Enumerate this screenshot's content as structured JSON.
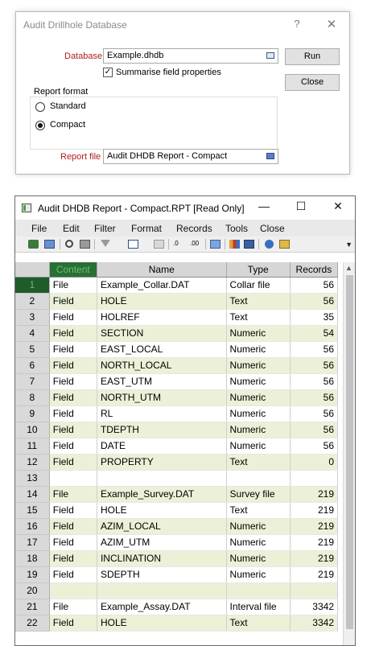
{
  "dialog": {
    "title": "Audit Drillhole Database",
    "help_icon": "?",
    "close_icon": "✕",
    "database_label": "Database",
    "database_value": "Example.dhdb",
    "summarise_checked": true,
    "summarise_label": "Summarise field properties",
    "report_format_label": "Report format",
    "radio_standard": "Standard",
    "radio_compact": "Compact",
    "selected_format": "Compact",
    "report_file_label": "Report file",
    "report_file_value": "Audit DHDB Report - Compact",
    "run_button": "Run",
    "close_button": "Close"
  },
  "report": {
    "title": "Audit DHDB Report - Compact.RPT [Read Only]",
    "minimize": "—",
    "maximize": "☐",
    "close": "✕",
    "menu": [
      "File",
      "Edit",
      "Filter",
      "Format",
      "Records",
      "Tools",
      "Close"
    ],
    "toolbar_icons": [
      "refresh-icon",
      "copy-icon",
      "find-icon",
      "print-icon",
      "filter-icon",
      "columns-icon",
      "grid-icon",
      "decrease-decimals-icon",
      "increase-decimals-icon",
      "export-icon",
      "chart-icon",
      "table-icon",
      "help-icon",
      "settings-icon"
    ],
    "columns": [
      "Content",
      "Name",
      "Type",
      "Records"
    ],
    "active_row": 1,
    "rows": [
      {
        "n": "1",
        "content": "File",
        "name": "Example_Collar.DAT",
        "type": "Collar file",
        "records": "56"
      },
      {
        "n": "2",
        "content": "Field",
        "name": "HOLE",
        "type": "Text",
        "records": "56"
      },
      {
        "n": "3",
        "content": "Field",
        "name": "HOLREF",
        "type": "Text",
        "records": "35"
      },
      {
        "n": "4",
        "content": "Field",
        "name": "SECTION",
        "type": "Numeric",
        "records": "54"
      },
      {
        "n": "5",
        "content": "Field",
        "name": "EAST_LOCAL",
        "type": "Numeric",
        "records": "56"
      },
      {
        "n": "6",
        "content": "Field",
        "name": "NORTH_LOCAL",
        "type": "Numeric",
        "records": "56"
      },
      {
        "n": "7",
        "content": "Field",
        "name": "EAST_UTM",
        "type": "Numeric",
        "records": "56"
      },
      {
        "n": "8",
        "content": "Field",
        "name": "NORTH_UTM",
        "type": "Numeric",
        "records": "56"
      },
      {
        "n": "9",
        "content": "Field",
        "name": "RL",
        "type": "Numeric",
        "records": "56"
      },
      {
        "n": "10",
        "content": "Field",
        "name": "TDEPTH",
        "type": "Numeric",
        "records": "56"
      },
      {
        "n": "11",
        "content": "Field",
        "name": "DATE",
        "type": "Numeric",
        "records": "56"
      },
      {
        "n": "12",
        "content": "Field",
        "name": "PROPERTY",
        "type": "Text",
        "records": "0"
      },
      {
        "n": "13",
        "content": "",
        "name": "",
        "type": "",
        "records": ""
      },
      {
        "n": "14",
        "content": "File",
        "name": "Example_Survey.DAT",
        "type": "Survey file",
        "records": "219"
      },
      {
        "n": "15",
        "content": "Field",
        "name": "HOLE",
        "type": "Text",
        "records": "219"
      },
      {
        "n": "16",
        "content": "Field",
        "name": "AZIM_LOCAL",
        "type": "Numeric",
        "records": "219"
      },
      {
        "n": "17",
        "content": "Field",
        "name": "AZIM_UTM",
        "type": "Numeric",
        "records": "219"
      },
      {
        "n": "18",
        "content": "Field",
        "name": "INCLINATION",
        "type": "Numeric",
        "records": "219"
      },
      {
        "n": "19",
        "content": "Field",
        "name": "SDEPTH",
        "type": "Numeric",
        "records": "219"
      },
      {
        "n": "20",
        "content": "",
        "name": "",
        "type": "",
        "records": ""
      },
      {
        "n": "21",
        "content": "File",
        "name": "Example_Assay.DAT",
        "type": "Interval file",
        "records": "3342"
      },
      {
        "n": "22",
        "content": "Field",
        "name": "HOLE",
        "type": "Text",
        "records": "3342"
      }
    ]
  }
}
